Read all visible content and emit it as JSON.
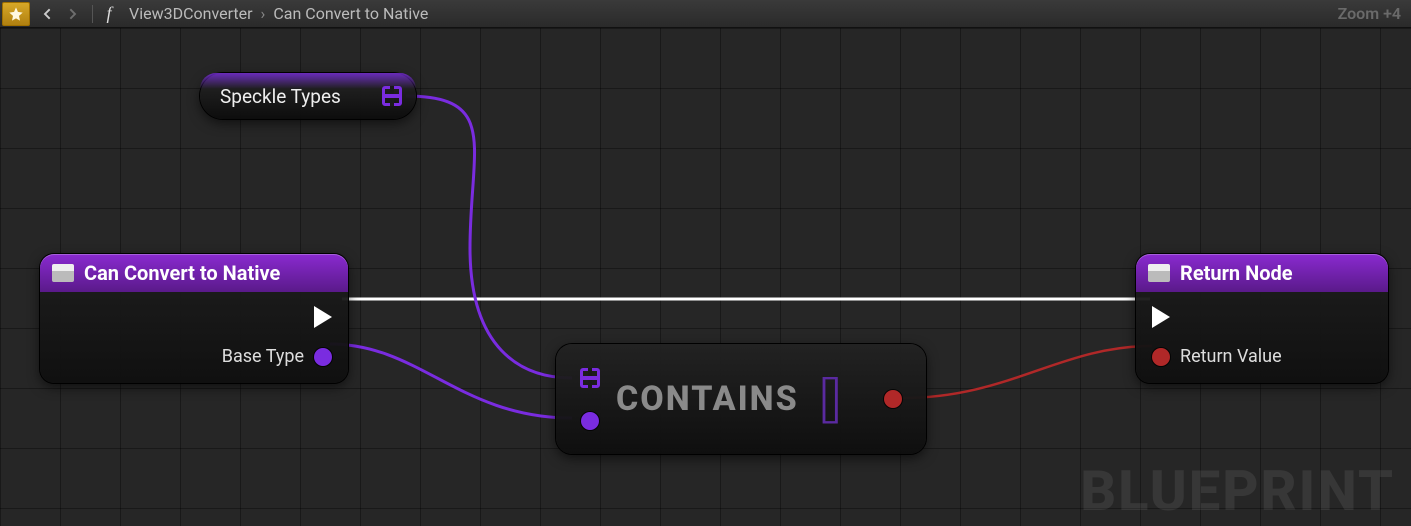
{
  "toolbar": {
    "breadcrumb": [
      "View3DConverter",
      "Can Convert to Native"
    ],
    "zoom_label": "Zoom +4"
  },
  "watermark": "BLUEPRINT",
  "nodes": {
    "speckle_var": {
      "label": "Speckle Types"
    },
    "entry": {
      "title": "Can Convert to Native",
      "pins": {
        "base_type": "Base Type"
      }
    },
    "contains": {
      "title": "CONTAINS"
    },
    "return": {
      "title": "Return Node",
      "pins": {
        "return_value": "Return Value"
      }
    }
  }
}
